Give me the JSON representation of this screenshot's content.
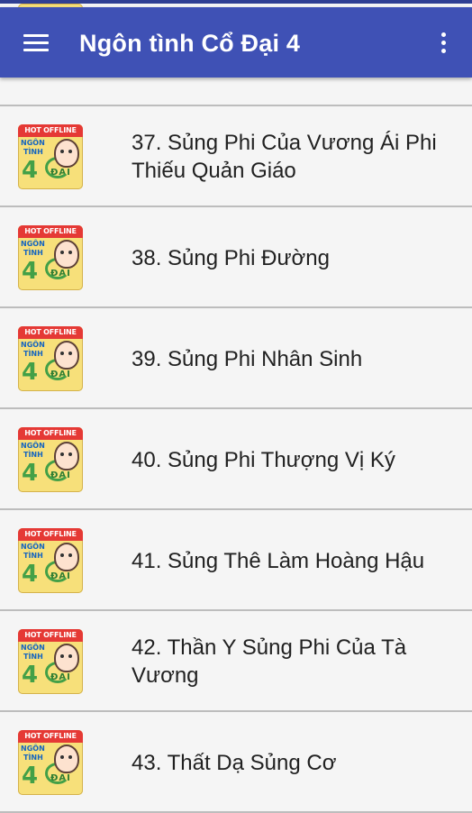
{
  "app_bar": {
    "title": "Ngôn tình Cổ Đại 4",
    "menu_icon": "hamburger-menu-icon",
    "overflow_icon": "more-vert-icon"
  },
  "thumbnail": {
    "ribbon": "HOT OFFLINE",
    "word1": "NGÔN",
    "word2": "TÌNH",
    "word3": "4",
    "word4": "ĐẠI"
  },
  "stories": [
    {
      "label": "37. Sủng Phi Của Vương Ái Phi Thiếu Quản Giáo"
    },
    {
      "label": "38. Sủng Phi Đường"
    },
    {
      "label": "39. Sủng Phi Nhân Sinh"
    },
    {
      "label": "40. Sủng Phi Thượng Vị Ký"
    },
    {
      "label": "41. Sủng Thê Làm Hoàng Hậu"
    },
    {
      "label": "42. Thần Y Sủng Phi Của Tà Vương"
    },
    {
      "label": "43. Thất Dạ Sủng Cơ"
    }
  ],
  "colors": {
    "primary": "#3f51b5",
    "primary_dark": "#2f3f93",
    "background": "#f5f5f5",
    "divider": "#bdbdbd"
  }
}
